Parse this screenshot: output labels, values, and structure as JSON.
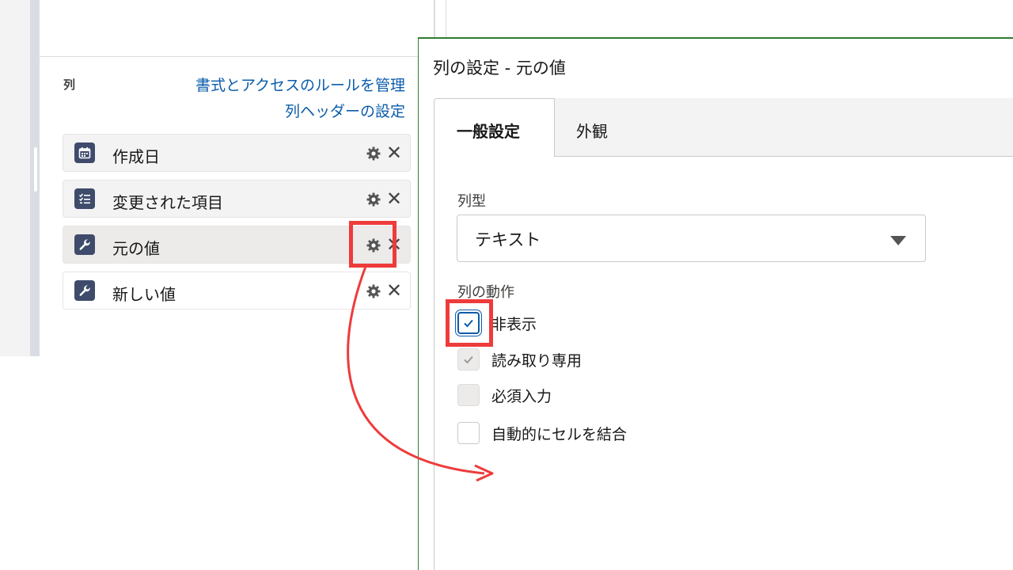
{
  "left": {
    "heading": "列",
    "link_manage_rules": "書式とアクセスのルールを管理",
    "link_column_headers": "列ヘッダーの設定",
    "items": [
      {
        "label": "作成日",
        "icon": "calendar-icon"
      },
      {
        "label": "変更された項目",
        "icon": "checklist-icon"
      },
      {
        "label": "元の値",
        "icon": "wrench-icon"
      },
      {
        "label": "新しい値",
        "icon": "wrench-icon"
      }
    ],
    "close_glyph": "✕"
  },
  "dialog": {
    "title": "列の設定 - 元の値",
    "tabs": [
      {
        "label": "一般設定",
        "active": true
      },
      {
        "label": "外観",
        "active": false
      }
    ],
    "column_type_label": "列型",
    "column_type_value": "テキスト",
    "behavior_label": "列の動作",
    "checkboxes": [
      {
        "label": "非表示",
        "checked": true,
        "disabled": false
      },
      {
        "label": "読み取り専用",
        "checked": true,
        "disabled": true
      },
      {
        "label": "必須入力",
        "checked": false,
        "disabled": true
      },
      {
        "label": "自動的にセルを結合",
        "checked": false,
        "disabled": false
      }
    ]
  },
  "colors": {
    "accent": "#0b5cab",
    "icon_bg": "#3e4b6b",
    "annotation_red": "#ee3b3b",
    "dialog_border": "#2e7d32"
  }
}
